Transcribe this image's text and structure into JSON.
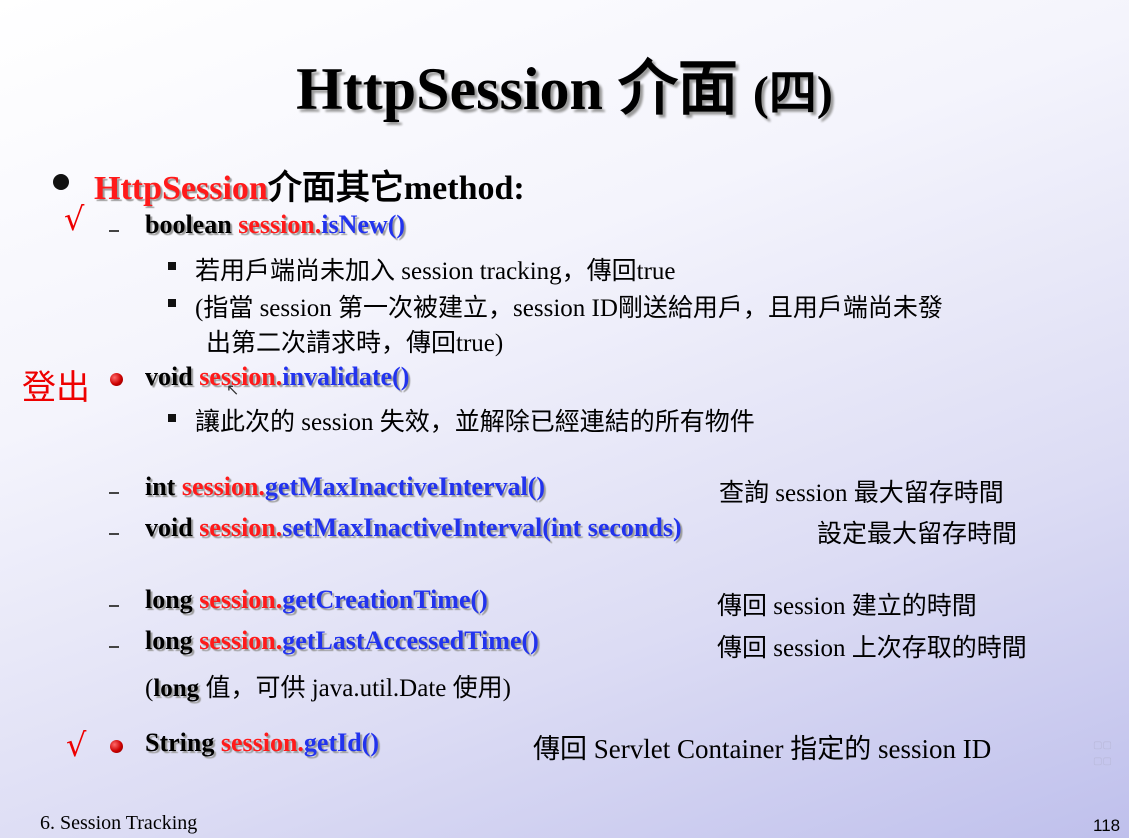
{
  "title": {
    "main": "HttpSession 介面 ",
    "paren": "(四)"
  },
  "heading": {
    "red": "HttpSession",
    "rest": "介面其它method:"
  },
  "items": {
    "isnew": {
      "kw": "boolean ",
      "obj": "session.",
      "method": "isNew()"
    },
    "isnew_note1": "若用戶端尚未加入 session tracking，傳回true",
    "isnew_note2a": "(指當 session 第一次被建立，session ID剛送給用戶，且用戶端尚未發",
    "isnew_note2b": "出第二次請求時，傳回true)",
    "invalidate": {
      "kw": "void ",
      "obj": "session.",
      "method": "invalidate()"
    },
    "invalidate_note": "讓此次的 session 失效，並解除已經連結的所有物件",
    "getmax": {
      "kw": "int ",
      "obj": "session.",
      "method": "getMaxInactiveInterval()",
      "desc": "查詢 session 最大留存時間"
    },
    "setmax": {
      "kw": "void ",
      "obj": "session.",
      "method": "setMaxInactiveInterval(int seconds)",
      "desc": "設定最大留存時間"
    },
    "creation": {
      "kw": "long ",
      "obj": "session.",
      "method": "getCreationTime()",
      "desc": "傳回 session 建立的時間"
    },
    "lastacc": {
      "kw": "long ",
      "obj": "session.",
      "method": "getLastAccessedTime()",
      "desc": "傳回 session 上次存取的時間"
    },
    "long_note": {
      "open": "(",
      "kw": "long",
      "rest": " 值，可供 java.util.Date 使用)"
    },
    "getid": {
      "kw": "String ",
      "obj": "session.",
      "method": "getId()",
      "desc": "傳回 Servlet Container 指定的 session ID"
    }
  },
  "annotations": {
    "check": "√",
    "logout": "登出"
  },
  "footer": {
    "section": "6. Session Tracking",
    "page": "118"
  }
}
